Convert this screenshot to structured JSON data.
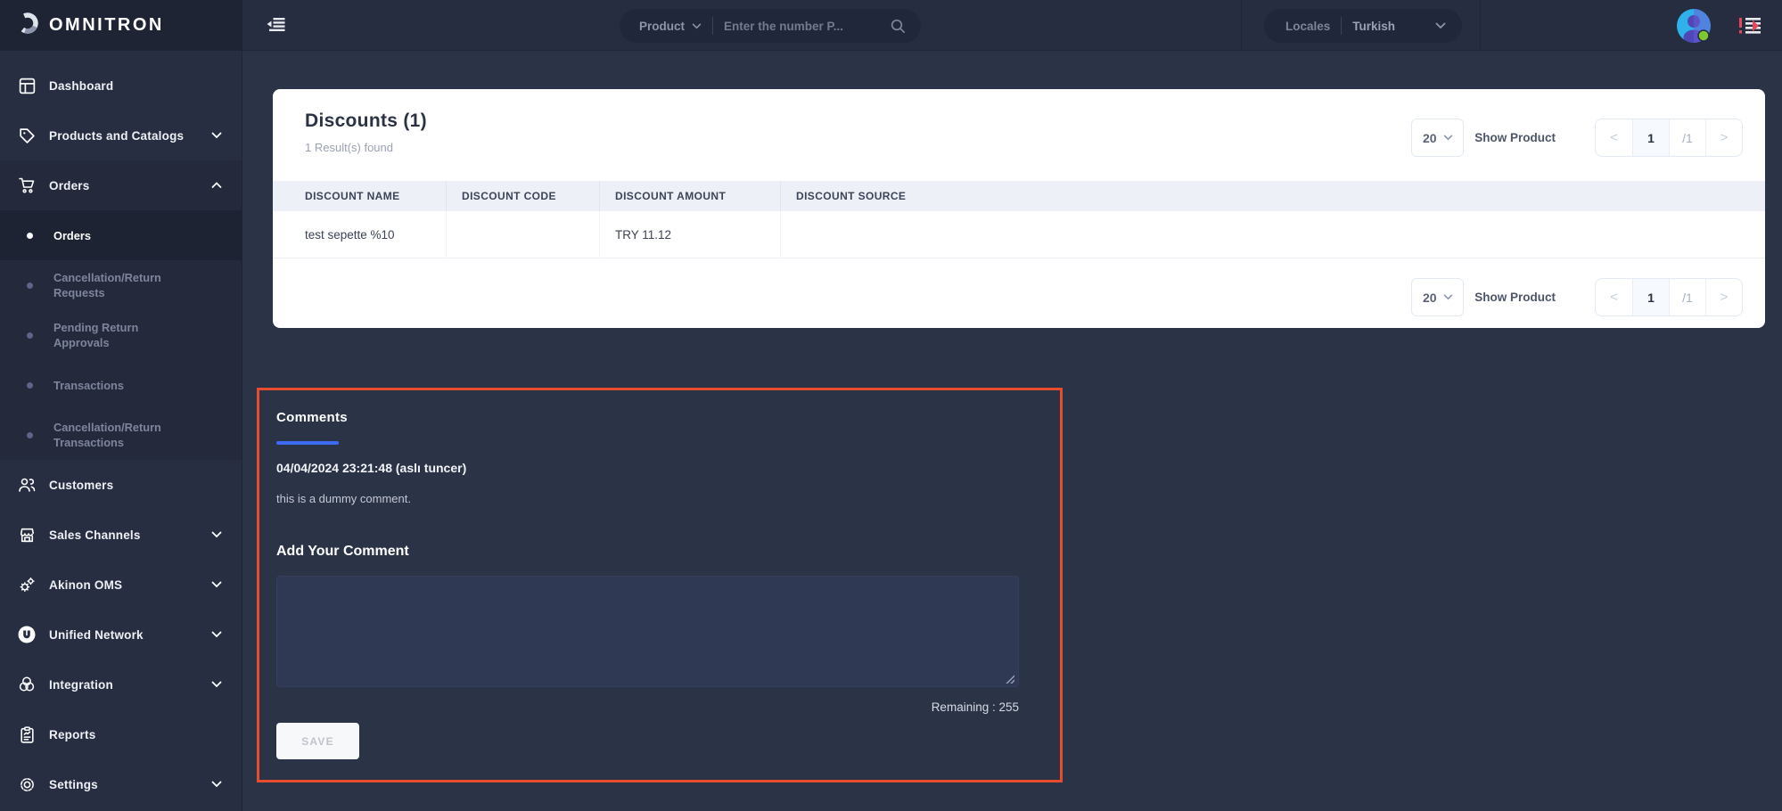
{
  "app": {
    "title": "OMNITRON"
  },
  "header": {
    "search_category": "Product",
    "search_placeholder": "Enter the number P...",
    "locales_label": "Locales",
    "locales_value": "Turkish"
  },
  "sidebar": {
    "items": [
      {
        "label": "Dashboard",
        "icon": "dashboard-icon"
      },
      {
        "label": "Products and Catalogs",
        "icon": "tag-icon",
        "chevron": "down"
      },
      {
        "label": "Orders",
        "icon": "cart-icon",
        "chevron": "up",
        "expanded": true
      },
      {
        "label": "Customers",
        "icon": "people-icon"
      },
      {
        "label": "Sales Channels",
        "icon": "store-icon",
        "chevron": "down"
      },
      {
        "label": "Akinon OMS",
        "icon": "gears-icon",
        "chevron": "down"
      },
      {
        "label": "Unified Network",
        "icon": "unified-network-icon",
        "chevron": "down"
      },
      {
        "label": "Integration",
        "icon": "integration-icon",
        "chevron": "down"
      },
      {
        "label": "Reports",
        "icon": "reports-icon"
      },
      {
        "label": "Settings",
        "icon": "settings-icon",
        "chevron": "down"
      }
    ],
    "orders_submenu": [
      {
        "label": "Orders",
        "active": true
      },
      {
        "label": "Cancellation/Return Requests",
        "active": false
      },
      {
        "label": "Pending Return Approvals",
        "active": false
      },
      {
        "label": "Transactions",
        "active": false
      },
      {
        "label": "Cancellation/Return Transactions",
        "active": false
      }
    ]
  },
  "discounts": {
    "title": "Discounts (1)",
    "results_found": "1 Result(s) found",
    "columns": [
      "DISCOUNT NAME",
      "DISCOUNT CODE",
      "DISCOUNT AMOUNT",
      "DISCOUNT SOURCE"
    ],
    "rows": [
      {
        "name": "test sepette %10",
        "code": "",
        "amount": "TRY 11.12",
        "source": ""
      }
    ],
    "pagination": {
      "page_size": "20",
      "action_label": "Show Product",
      "prev": "<",
      "current": "1",
      "total": "/1",
      "next": ">"
    }
  },
  "comments": {
    "tab_label": "Comments",
    "entries": [
      {
        "meta": "04/04/2024 23:21:48 (aslı tuncer)",
        "text": "this is a dummy comment."
      }
    ],
    "add_label": "Add Your Comment",
    "remaining": "Remaining : 255",
    "save_label": "SAVE"
  },
  "colors": {
    "accent_blue": "#3e6bf4",
    "highlight_red": "#e84c2f",
    "avatar_blue": "#2fb1ea",
    "online_green": "#7ec832",
    "sidebar_bg": "#272e41",
    "page_bg": "#2b3347"
  }
}
